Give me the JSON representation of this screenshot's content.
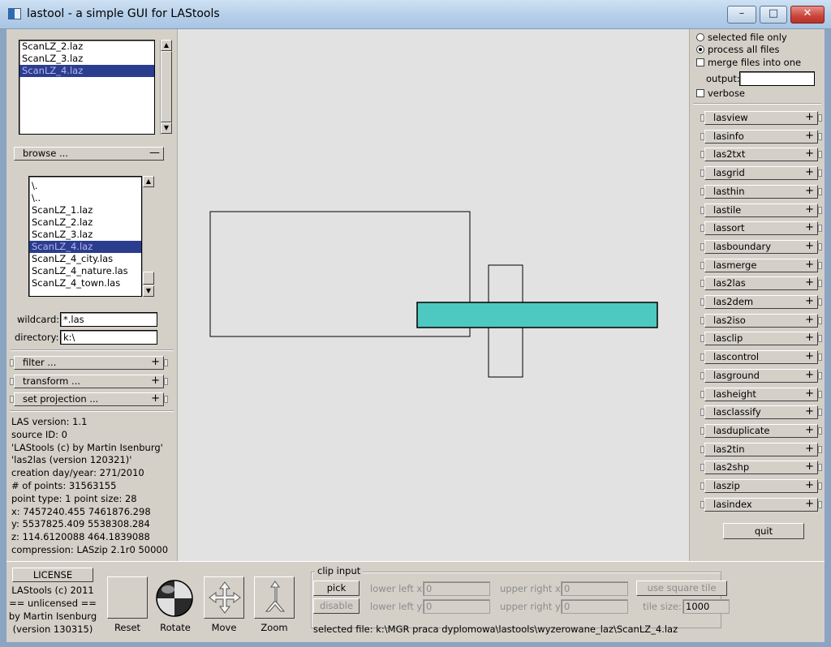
{
  "window": {
    "title": "lastool - a simple GUI for LAStools",
    "minimize": "–",
    "maximize": "□",
    "close": "✕"
  },
  "file_list": {
    "items": [
      "ScanLZ_2.laz",
      "ScanLZ_3.laz",
      "ScanLZ_4.laz"
    ],
    "selected": 2
  },
  "browse": {
    "label": "browse ...",
    "sign": "—",
    "items": [
      "\\.",
      "\\..",
      "ScanLZ_1.laz",
      "ScanLZ_2.laz",
      "ScanLZ_3.laz",
      "ScanLZ_4.laz",
      "ScanLZ_4_city.las",
      "ScanLZ_4_nature.las",
      "ScanLZ_4_town.las"
    ],
    "selected": 5,
    "wildcard_label": "wildcard:",
    "wildcard_value": "*.las",
    "directory_label": "directory:",
    "directory_value": "k:\\"
  },
  "sections": [
    {
      "label": "filter ...",
      "sign": "+"
    },
    {
      "label": "transform ...",
      "sign": "+"
    },
    {
      "label": "set projection ...",
      "sign": "+"
    }
  ],
  "info": [
    "LAS version: 1.1",
    "source ID: 0",
    "'LAStools (c) by Martin Isenburg'",
    "'las2las (version 120321)'",
    "creation day/year: 271/2010",
    "# of points: 31563155",
    "point type: 1 point size: 28",
    "x: 7457240.455 7461876.298",
    "y: 5537825.409 5538308.284",
    "z: 114.6120088 464.1839088",
    "compression: LASzip 2.1r0 50000"
  ],
  "options": {
    "selected_file_only": "selected file only",
    "process_all_files": "process all files",
    "merge_files": "merge files into one",
    "output_label": "output:",
    "output_value": "",
    "verbose": "verbose"
  },
  "tools": [
    "lasview",
    "lasinfo",
    "las2txt",
    "lasgrid",
    "lasthin",
    "lastile",
    "lassort",
    "lasboundary",
    "lasmerge",
    "las2las",
    "las2dem",
    "las2iso",
    "lasclip",
    "lascontrol",
    "lasground",
    "lasheight",
    "lasclassify",
    "lasduplicate",
    "las2tin",
    "las2shp",
    "laszip",
    "lasindex"
  ],
  "tool_sign": "+",
  "quit_label": "quit",
  "license": {
    "button": "LICENSE",
    "lines": [
      "LAStools (c) 2011",
      "== unlicensed ==",
      "by Martin Isenburg",
      "(version 130315)"
    ]
  },
  "view_tools": {
    "reset": "Reset",
    "rotate": "Rotate",
    "move": "Move",
    "zoom": "Zoom"
  },
  "clip": {
    "title": "clip input",
    "pick": "pick",
    "disable": "disable",
    "lower_left_x_label": "lower left x:",
    "lower_left_x": "0",
    "upper_right_x_label": "upper right x:",
    "upper_right_x": "0",
    "lower_left_y_label": "lower left y:",
    "lower_left_y": "0",
    "upper_right_y_label": "upper right y:",
    "upper_right_y": "0",
    "square_tile": "use square tile",
    "tile_size_label": "tile size:",
    "tile_size": "1000"
  },
  "status": "selected file: k:\\MGR praca dyplomowa\\lastools\\wyzerowane_laz\\ScanLZ_4.laz",
  "colors": {
    "selection_bg": "#2b3d8f",
    "selection_fg": "#b9b4ee",
    "tile_fill": "#4dc9c1",
    "panel": "#d4d0c8"
  }
}
